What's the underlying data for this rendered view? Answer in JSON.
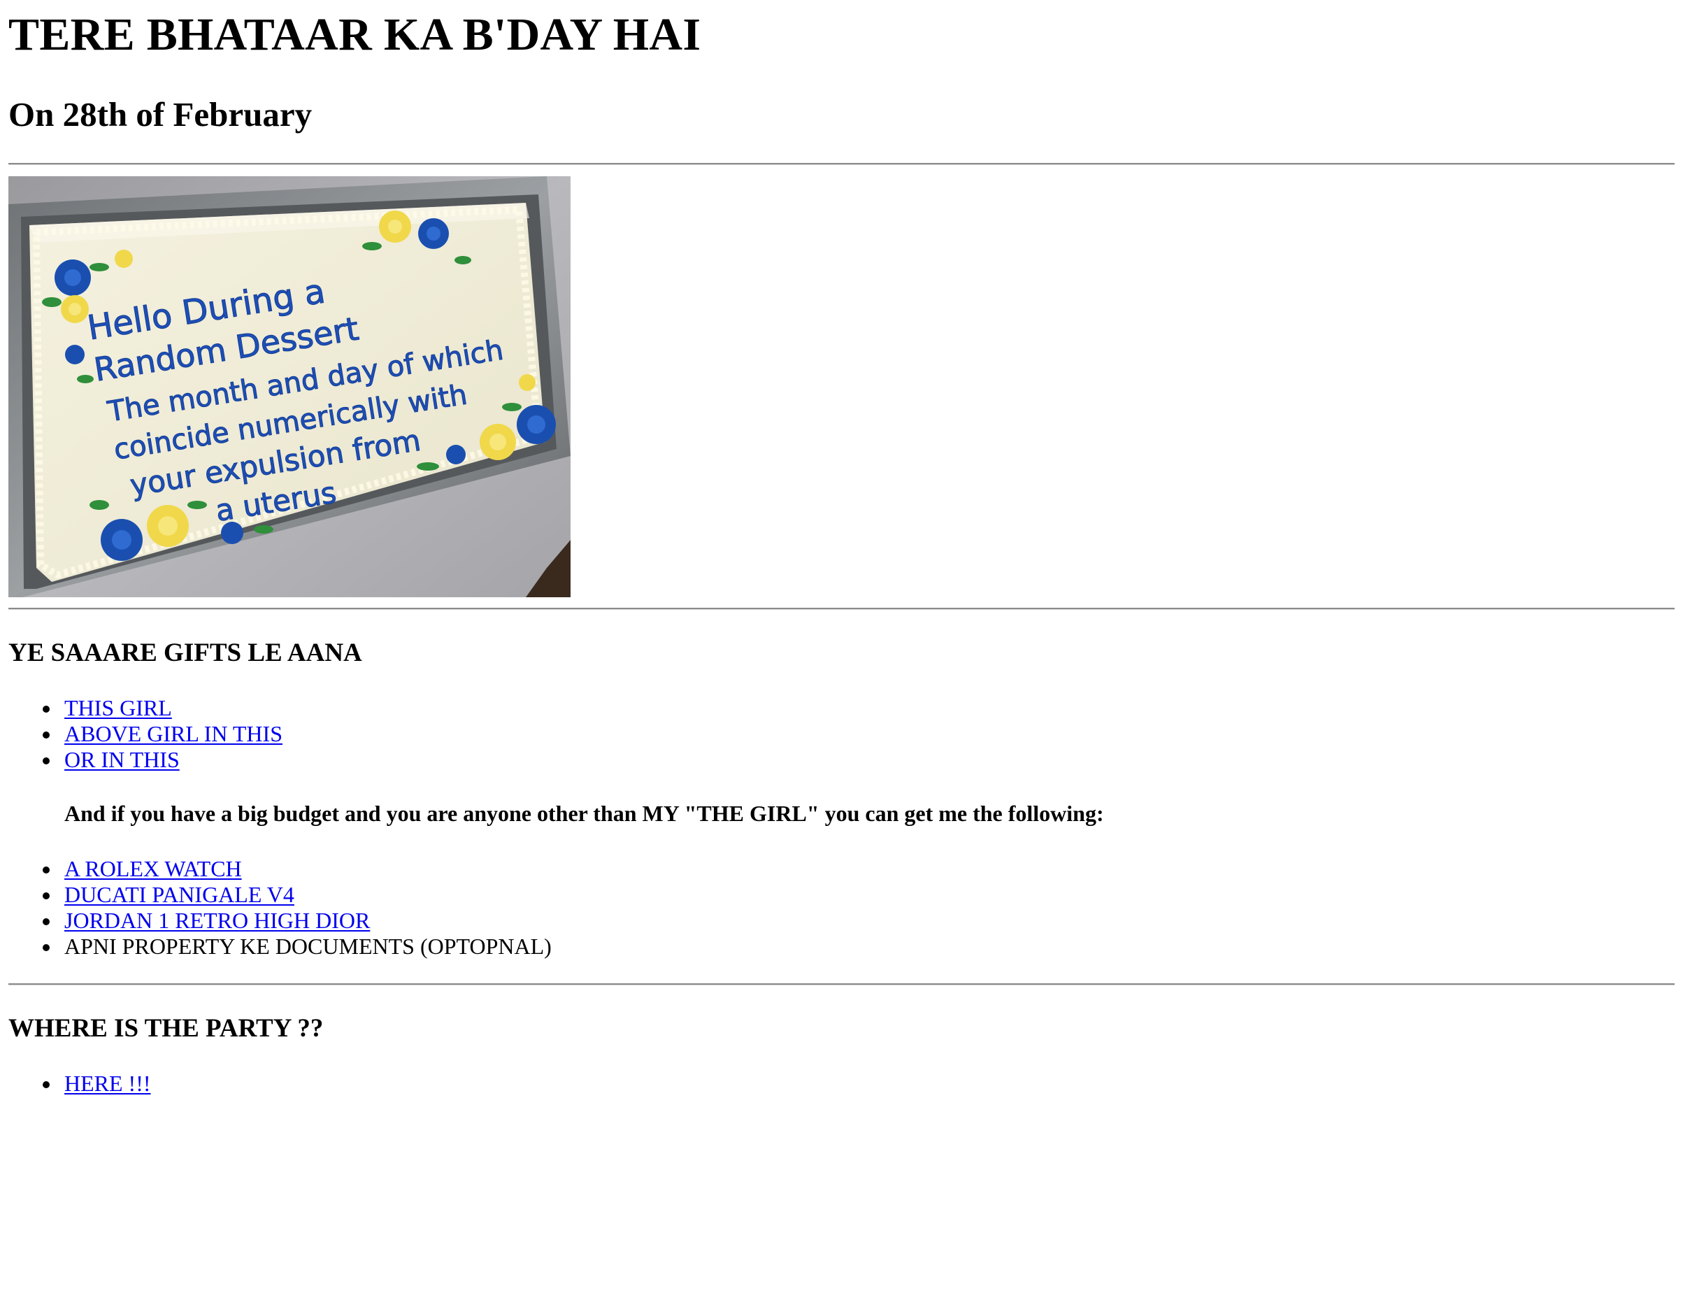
{
  "header": {
    "title": "TERE BHATAAR KA B'DAY HAI",
    "subtitle": "On 28th of February"
  },
  "cake_image": {
    "lines": [
      "Hello During a",
      "Random Dessert",
      "The month and day of which",
      "coincide numerically with",
      "your expulsion from",
      "a uterus"
    ]
  },
  "gifts": {
    "heading": "YE SAAARE GIFTS LE AANA",
    "items": [
      {
        "label": "THIS GIRL"
      },
      {
        "label": "ABOVE GIRL IN THIS"
      },
      {
        "label": "OR IN THIS"
      }
    ],
    "budget_note": "And if you have a big budget and you are anyone other than MY \"THE GIRL\" you can get me the following:",
    "big_items": [
      {
        "label": "A ROLEX WATCH"
      },
      {
        "label": "DUCATI PANIGALE V4"
      },
      {
        "label": "JORDAN 1 RETRO HIGH DIOR"
      }
    ],
    "plain_item": "APNI PROPERTY KE DOCUMENTS (OPTOPNAL)"
  },
  "party": {
    "heading": "WHERE IS THE PARTY ??",
    "link_label": "HERE !!!"
  },
  "colors": {
    "link": "#0000ee",
    "text": "#000000",
    "icing_text": "#1d4fb8"
  }
}
